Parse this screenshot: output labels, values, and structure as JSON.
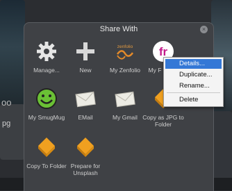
{
  "background": {
    "left_label_1": "oo",
    "left_label_2": "pg"
  },
  "dialog": {
    "title": "Share With",
    "close_glyph": "×",
    "items": [
      {
        "label": "Manage...",
        "icon": "gear-icon"
      },
      {
        "label": "New",
        "icon": "plus-icon"
      },
      {
        "label": "My Zenfolio",
        "icon": "zenfolio-icon"
      },
      {
        "label": "My F",
        "icon": "fr-icon"
      },
      {
        "label": "My SmugMug",
        "icon": "smugmug-icon"
      },
      {
        "label": "EMail",
        "icon": "envelope-icon"
      },
      {
        "label": "My Gmail",
        "icon": "envelope-icon"
      },
      {
        "label": "Copy as JPG to Folder",
        "icon": "folder-diamond-icon"
      },
      {
        "label": "Copy To Folder",
        "icon": "folder-diamond-icon"
      },
      {
        "label": "Prepare for Unsplash",
        "icon": "folder-diamond-icon"
      }
    ]
  },
  "context_menu": {
    "items": [
      "Details...",
      "Duplicate...",
      "Rename...",
      "Delete"
    ],
    "selected_index": 0
  },
  "colors": {
    "popup_bg": "#3f4145",
    "menu_highlight": "#3478d6",
    "diamond_orange": "#f0a020"
  }
}
